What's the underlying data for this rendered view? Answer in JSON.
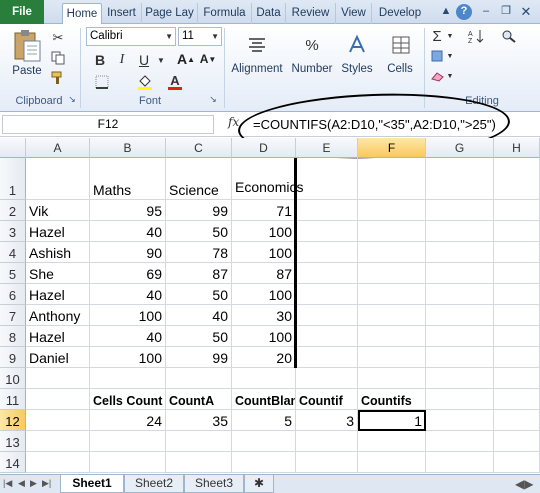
{
  "ribbon_tabs": [
    "File",
    "Home",
    "Insert",
    "Page Lay",
    "Formula",
    "Data",
    "Review",
    "View",
    "Develop"
  ],
  "active_tab": "Home",
  "clipboard": {
    "paste_label": "Paste",
    "group_label": "Clipboard"
  },
  "font": {
    "name": "Calibri",
    "size": "11",
    "group_label": "Font",
    "bold": "B",
    "italic": "I",
    "underline": "U",
    "color_letter": "A"
  },
  "groups": {
    "alignment": "Alignment",
    "number": "Number",
    "styles": "Styles",
    "cells": "Cells",
    "editing": "Editing",
    "number_icon": "%"
  },
  "formula_bar": {
    "name_box": "F12",
    "fx": "fx",
    "formula": "=COUNTIFS(A2:D10,\"<35\",A2:D10,\">25\")"
  },
  "columns": [
    "A",
    "B",
    "C",
    "D",
    "E",
    "F",
    "G",
    "H"
  ],
  "rows": [
    "1",
    "2",
    "3",
    "4",
    "5",
    "6",
    "7",
    "8",
    "9",
    "10",
    "11",
    "12",
    "13",
    "14"
  ],
  "selected_cell": {
    "column": "F",
    "row": "12"
  },
  "cells": {
    "header": [
      "",
      "Maths",
      "Science",
      "Economics"
    ],
    "data": [
      [
        "Vik",
        "95",
        "99",
        "71"
      ],
      [
        "Hazel",
        "40",
        "50",
        "100"
      ],
      [
        "Ashish",
        "90",
        "78",
        "100"
      ],
      [
        "She",
        "69",
        "87",
        "87"
      ],
      [
        "Hazel",
        "40",
        "50",
        "100"
      ],
      [
        "Anthony",
        "100",
        "40",
        "30"
      ],
      [
        "Hazel",
        "40",
        "50",
        "100"
      ],
      [
        "Daniel",
        "100",
        "99",
        "20"
      ]
    ],
    "row11": [
      "Cells Count",
      "CountA",
      "CountBlank",
      "Countif",
      "Countifs"
    ],
    "row12": [
      "24",
      "35",
      "5",
      "3",
      "1"
    ]
  },
  "sheets": [
    "Sheet1",
    "Sheet2",
    "Sheet3"
  ],
  "active_sheet": "Sheet1"
}
